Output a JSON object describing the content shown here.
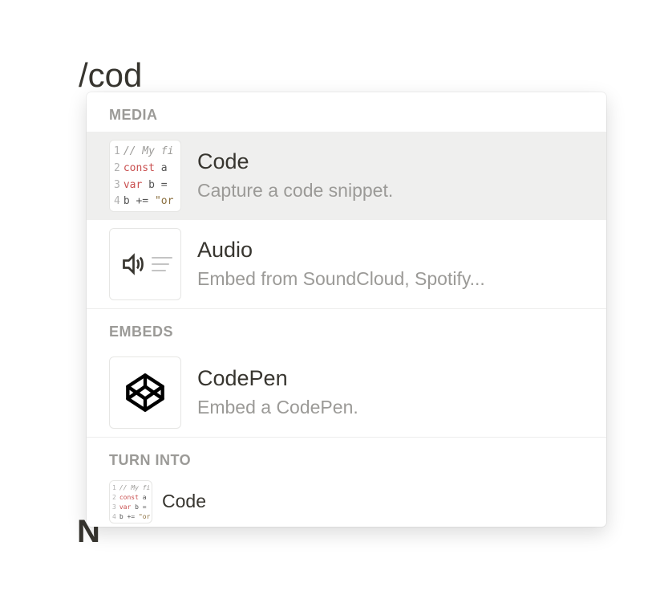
{
  "editor": {
    "input_text": "/cod"
  },
  "menu": {
    "sections": [
      {
        "header": "MEDIA",
        "items": [
          {
            "title": "Code",
            "desc": "Capture a code snippet.",
            "icon": "code-thumb",
            "highlighted": true
          },
          {
            "title": "Audio",
            "desc": "Embed from SoundCloud, Spotify...",
            "icon": "audio-thumb",
            "highlighted": false
          }
        ]
      },
      {
        "header": "EMBEDS",
        "items": [
          {
            "title": "CodePen",
            "desc": "Embed a CodePen.",
            "icon": "codepen-icon",
            "highlighted": false
          }
        ]
      },
      {
        "header": "TURN INTO",
        "items": [
          {
            "title": "Code",
            "desc": "",
            "icon": "code-thumb-small",
            "highlighted": false
          }
        ]
      }
    ]
  },
  "code_thumb": {
    "l1_comment": "// My fi",
    "l2_kw": "const",
    "l2_rest": " a",
    "l3_kw": "var",
    "l3_rest": " b =",
    "l4_pre": "b += ",
    "l4_str": "\"or"
  }
}
